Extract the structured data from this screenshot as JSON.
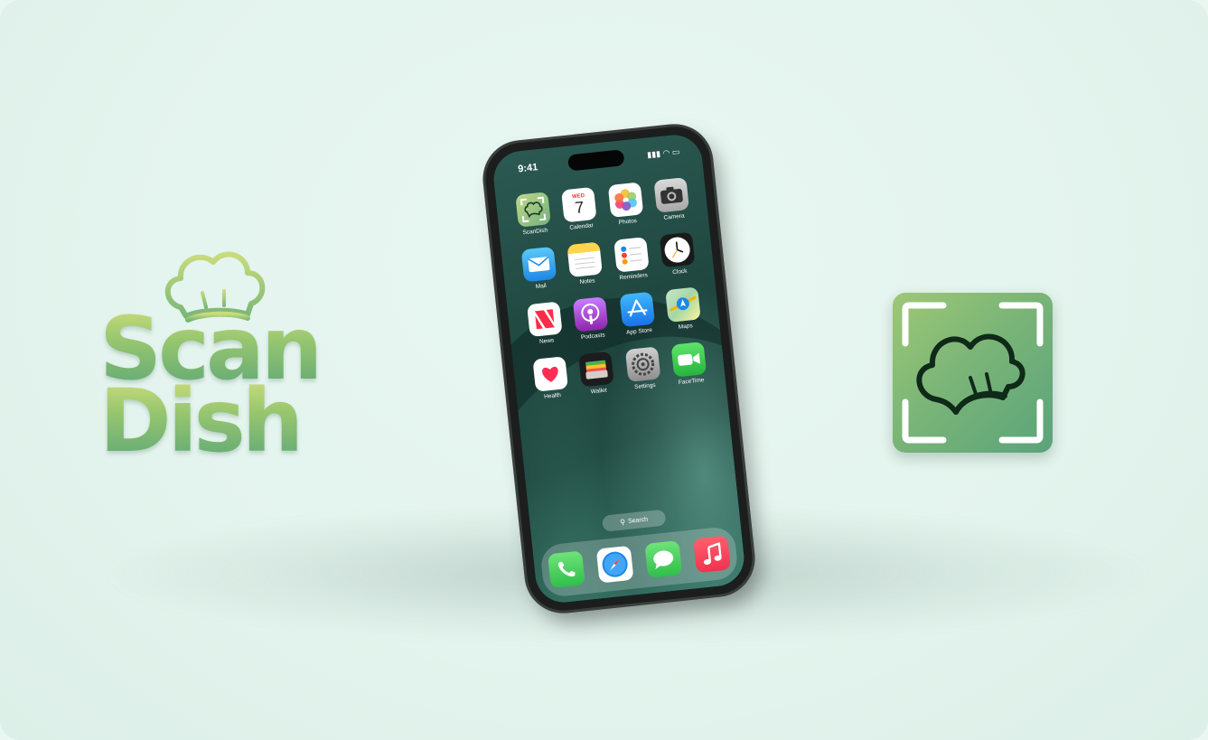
{
  "brand": {
    "wordmark_line1": "Scan",
    "wordmark_line2": "Dish",
    "logo_icon": "chef-hat-icon",
    "app_icon": "chef-hat-scan-icon",
    "colors": {
      "green_light": "#cddc7b",
      "green_mid": "#7bb577",
      "green_dark": "#5aa37b",
      "background": "#e3f3ed"
    }
  },
  "phone": {
    "status_time": "9:41",
    "status_icons": "▮▮▮ ◠ ▭",
    "home_apps": [
      {
        "label": "ScanDish",
        "icon": "scandish-icon"
      },
      {
        "label": "Calendar",
        "icon": "calendar-icon",
        "day": "WED",
        "date": "7"
      },
      {
        "label": "Photos",
        "icon": "photos-icon"
      },
      {
        "label": "Camera",
        "icon": "camera-icon"
      },
      {
        "label": "Mail",
        "icon": "mail-icon"
      },
      {
        "label": "Notes",
        "icon": "notes-icon"
      },
      {
        "label": "Reminders",
        "icon": "reminders-icon"
      },
      {
        "label": "Clock",
        "icon": "clock-icon"
      },
      {
        "label": "News",
        "icon": "news-icon"
      },
      {
        "label": "Podcasts",
        "icon": "podcasts-icon"
      },
      {
        "label": "App Store",
        "icon": "app-store-icon"
      },
      {
        "label": "Maps",
        "icon": "maps-icon"
      },
      {
        "label": "Health",
        "icon": "health-icon"
      },
      {
        "label": "Wallet",
        "icon": "wallet-icon"
      },
      {
        "label": "Settings",
        "icon": "settings-icon"
      },
      {
        "label": "FaceTime",
        "icon": "facetime-icon"
      }
    ],
    "search_label": "Search",
    "dock": [
      {
        "icon": "phone-icon"
      },
      {
        "icon": "safari-icon"
      },
      {
        "icon": "messages-icon"
      },
      {
        "icon": "music-icon"
      }
    ]
  }
}
